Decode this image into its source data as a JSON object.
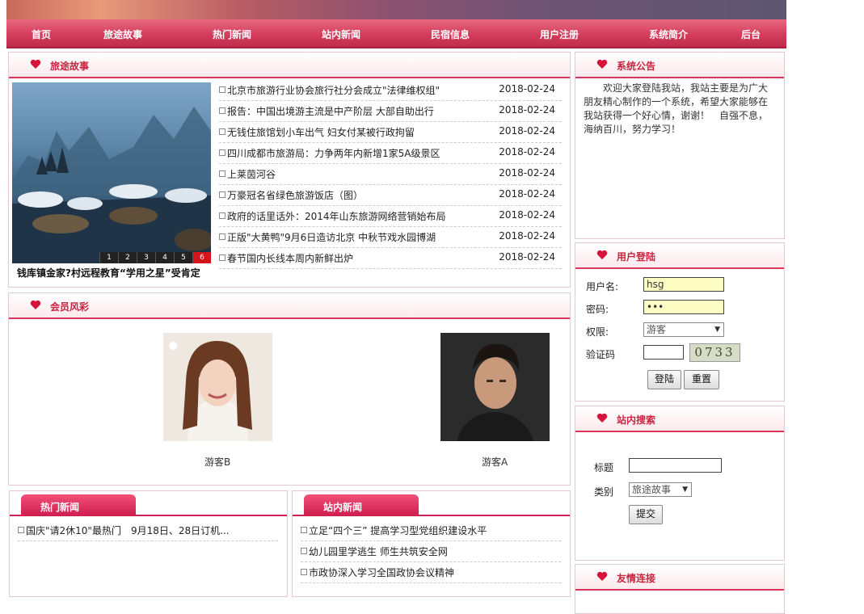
{
  "nav": [
    "首页",
    "旅途故事",
    "热门新闻",
    "站内新闻",
    "民宿信息",
    "用户注册",
    "系统简介",
    "后台"
  ],
  "travel": {
    "title": "旅途故事",
    "caption": "钱库镇金家?村远程教育“学用之星”受肯定",
    "thumbs": [
      "1",
      "2",
      "3",
      "4",
      "5",
      "6"
    ],
    "active_thumb": 6,
    "news": [
      {
        "title": "北京市旅游行业协会旅行社分会成立\"法律维权组\"",
        "date": "2018-02-24"
      },
      {
        "title": "报告：中国出境游主流是中产阶层 大部自助出行",
        "date": "2018-02-24"
      },
      {
        "title": "无钱住旅馆划小车出气 妇女付某被行政拘留",
        "date": "2018-02-24"
      },
      {
        "title": "四川成都市旅游局：力争两年内新增1家5A级景区",
        "date": "2018-02-24"
      },
      {
        "title": "上莱茵河谷",
        "date": "2018-02-24"
      },
      {
        "title": "万豪冠名省绿色旅游饭店（图）",
        "date": "2018-02-24"
      },
      {
        "title": "政府的话里话外：2014年山东旅游网络营销始布局",
        "date": "2018-02-24"
      },
      {
        "title": "正版\"大黄鸭\"9月6日造访北京 中秋节戏水园博湖",
        "date": "2018-02-24"
      },
      {
        "title": "春节国内长线本周内新鲜出炉",
        "date": "2018-02-24"
      }
    ]
  },
  "members": {
    "title": "会员风彩",
    "items": [
      {
        "name": "游客B"
      },
      {
        "name": "游客A"
      }
    ]
  },
  "hot": {
    "title": "热门新闻",
    "items": [
      "国庆\"请2休10\"最热门　9月18日、28日订机..."
    ]
  },
  "site": {
    "title": "站内新闻",
    "items": [
      "立足“四个三” 提高学习型党组织建设水平",
      "幼儿园里学逃生 师生共筑安全网",
      "市政协深入学习全国政协会议精神"
    ]
  },
  "notice": {
    "title": "系统公告",
    "text": "欢迎大家登陆我站，我站主要是为广大朋友精心制作的一个系统，希望大家能够在我站获得一个好心情，谢谢！　自强不息，海纳百川，努力学习！"
  },
  "login": {
    "title": "用户登陆",
    "username_label": "用户名:",
    "username_value": "hsg",
    "password_label": "密码:",
    "password_value": "•••",
    "role_label": "权限:",
    "role_value": "游客",
    "captcha_label": "验证码",
    "captcha_text": "0733",
    "login_button": "登陆",
    "reset_button": "重置"
  },
  "search": {
    "title": "站内搜索",
    "title_label": "标题",
    "category_label": "类别",
    "category_value": "旅途故事",
    "submit": "提交"
  },
  "links": {
    "title": "友情连接"
  },
  "colors": {
    "accent": "#d8375a",
    "nav": "#d23a5a",
    "heading": "#c8233f"
  }
}
